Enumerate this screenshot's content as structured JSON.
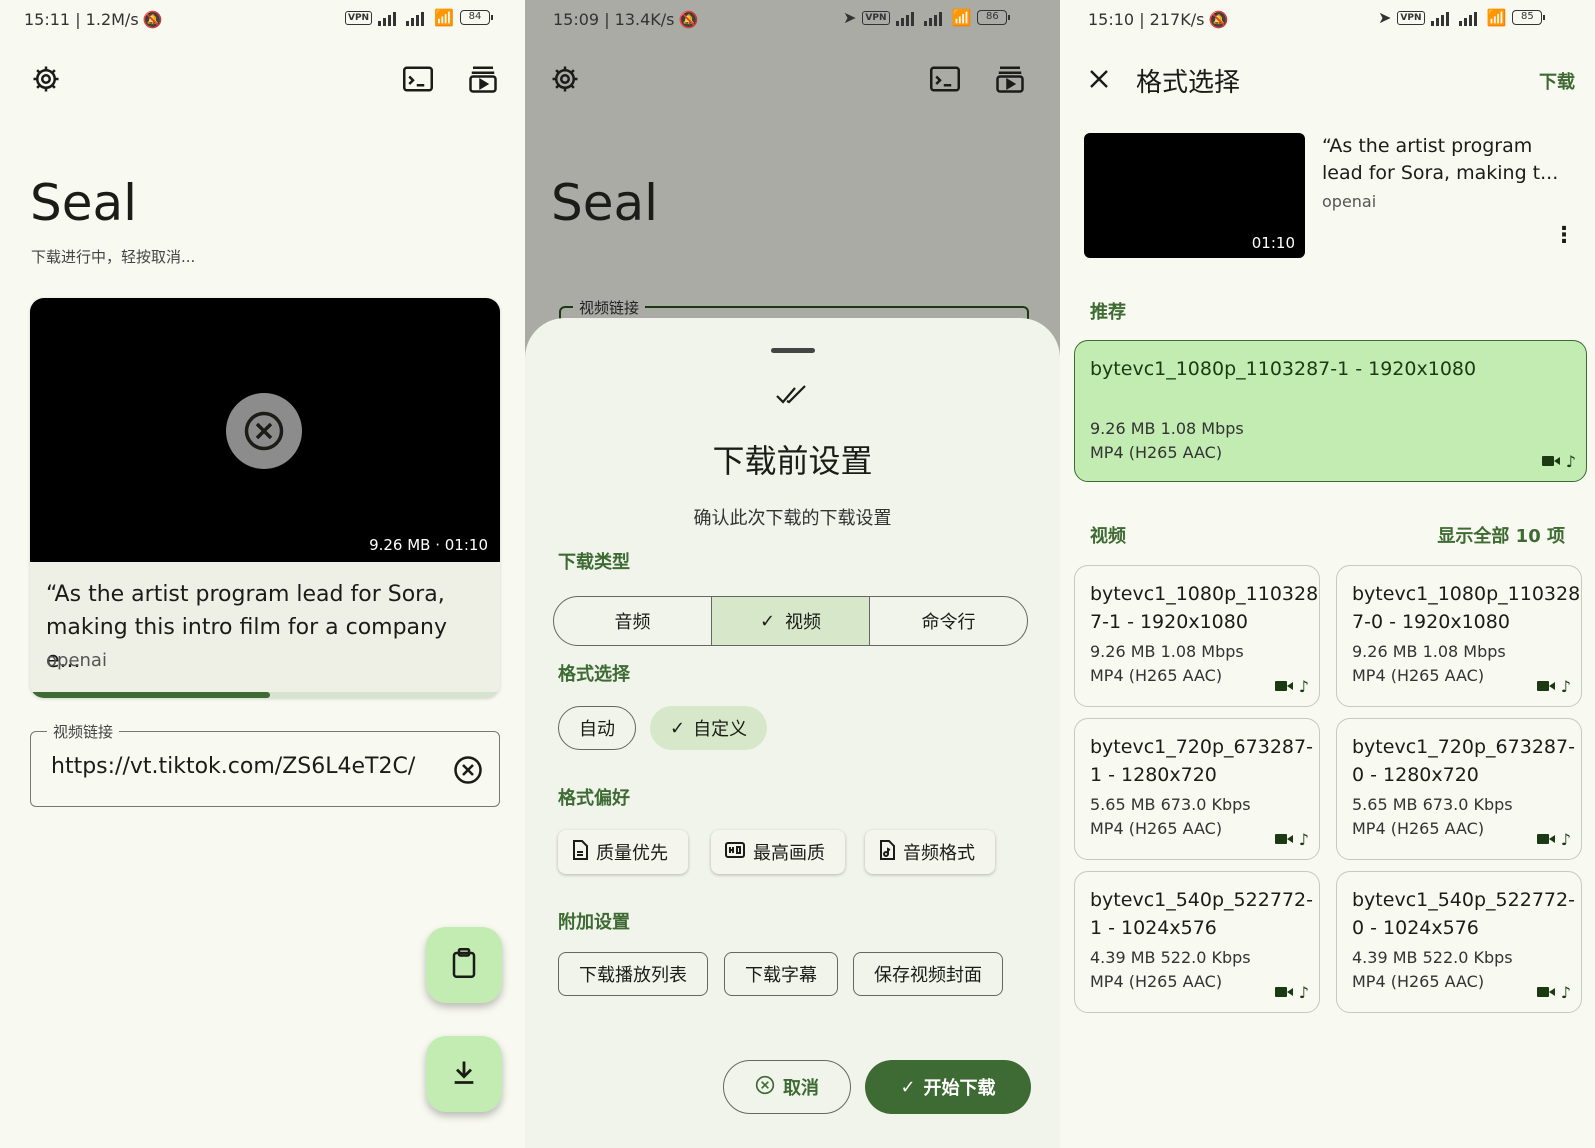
{
  "panel1": {
    "status": {
      "time": "15:11 | 1.2M/s",
      "battery": "84"
    },
    "app_title": "Seal",
    "subtitle": "下载进行中，轻按取消...",
    "video": {
      "meta": "9.26 MB · 01:10",
      "title": "“As the artist program lead for Sora, making this intro film for a company e...",
      "author": "openai",
      "progress": 0.51
    },
    "url_field": {
      "label": "视频链接",
      "value": "https://vt.tiktok.com/ZS6L4eT2C/"
    }
  },
  "panel2": {
    "status": {
      "time": "15:09 | 13.4K/s",
      "battery": "86"
    },
    "app_title": "Seal",
    "url_label": "视频链接",
    "sheet": {
      "title": "下载前设置",
      "subtitle": "确认此次下载的下载设置",
      "download_type_label": "下载类型",
      "download_types": [
        "音频",
        "视频",
        "命令行"
      ],
      "selected_type": "视频",
      "format_select_label": "格式选择",
      "format_auto": "自动",
      "format_custom": "自定义",
      "format_pref_label": "格式偏好",
      "pref_quality": "质量优先",
      "pref_best": "最高画质",
      "pref_audio": "音频格式",
      "extra_label": "附加设置",
      "extra_playlist": "下载播放列表",
      "extra_subtitle": "下载字幕",
      "extra_cover": "保存视频封面",
      "cancel": "取消",
      "start": "开始下载"
    }
  },
  "panel3": {
    "status": {
      "time": "15:10 | 217K/s",
      "battery": "85"
    },
    "title": "格式选择",
    "action": "下载",
    "video": {
      "duration": "01:10",
      "title": "“As the artist program lead for Sora, making t...",
      "author": "openai"
    },
    "recommended_label": "推荐",
    "recommended": {
      "name": "bytevc1_1080p_1103287-1 - 1920x1080",
      "size": "9.26 MB 1.08 Mbps",
      "codec": "MP4 (H265 AAC)"
    },
    "video_label": "视频",
    "show_all": "显示全部 10 项",
    "formats": [
      {
        "name": "bytevc1_1080p_110328\n7-1 - 1920x1080",
        "size": "9.26 MB 1.08 Mbps",
        "codec": "MP4 (H265 AAC)"
      },
      {
        "name": "bytevc1_1080p_110328\n7-0 - 1920x1080",
        "size": "9.26 MB 1.08 Mbps",
        "codec": "MP4 (H265 AAC)"
      },
      {
        "name": "bytevc1_720p_673287-\n1 - 1280x720",
        "size": "5.65 MB 673.0 Kbps",
        "codec": "MP4 (H265 AAC)"
      },
      {
        "name": "bytevc1_720p_673287-\n0 - 1280x720",
        "size": "5.65 MB 673.0 Kbps",
        "codec": "MP4 (H265 AAC)"
      },
      {
        "name": "bytevc1_540p_522772-\n1 - 1024x576",
        "size": "4.39 MB 522.0 Kbps",
        "codec": "MP4 (H265 AAC)"
      },
      {
        "name": "bytevc1_540p_522772-\n0 - 1024x576",
        "size": "4.39 MB 522.0 Kbps",
        "codec": "MP4 (H265 AAC)"
      }
    ]
  },
  "colors": {
    "accent": "#3e6b33",
    "container": "#c2ecb2",
    "surface": "#f8f9f1"
  }
}
